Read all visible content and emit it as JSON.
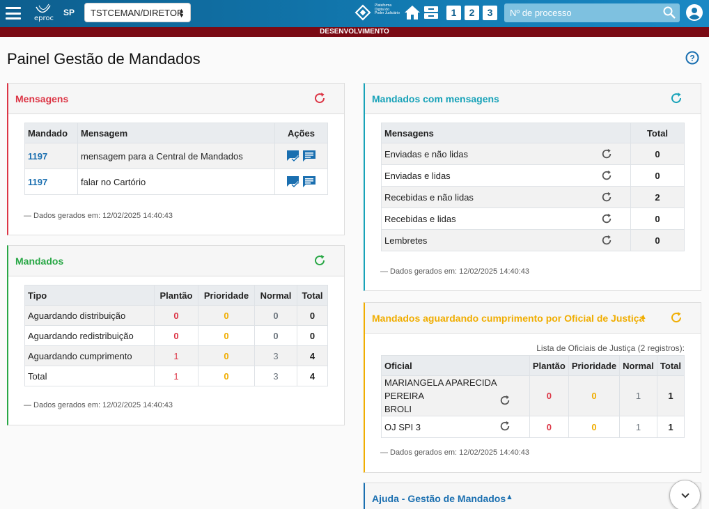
{
  "header": {
    "logo_text": "eproc",
    "region": "SP",
    "profile": "TSTCEMAN/DIRETOR",
    "platform_text": [
      "Plataforma",
      "Digital do",
      "Poder Judiciário"
    ],
    "shortcuts": [
      "1",
      "2",
      "3"
    ],
    "search_placeholder": "Nº de processo"
  },
  "env_banner": "DESENVOLVIMENTO",
  "page_title": "Painel Gestão de Mandados",
  "mensagens": {
    "title": "Mensagens",
    "columns": [
      "Mandado",
      "Mensagem",
      "Ações"
    ],
    "rows": [
      {
        "mandado": "1197",
        "mensagem": "mensagem para a Central de Mandados"
      },
      {
        "mandado": "1197",
        "mensagem": "falar no Cartório"
      }
    ],
    "footnote": "— Dados gerados em: 12/02/2025 14:40:43"
  },
  "mandados": {
    "title": "Mandados",
    "columns": [
      "Tipo",
      "Plantão",
      "Prioridade",
      "Normal",
      "Total"
    ],
    "rows": [
      {
        "tipo": "Aguardando distribuição",
        "plantao": "0",
        "prioridade": "0",
        "normal": "0",
        "total": "0"
      },
      {
        "tipo": "Aguardando redistribuição",
        "plantao": "0",
        "prioridade": "0",
        "normal": "0",
        "total": "0"
      },
      {
        "tipo": "Aguardando cumprimento",
        "plantao": "1",
        "prioridade": "0",
        "normal": "3",
        "total": "4"
      },
      {
        "tipo": "Total",
        "plantao": "1",
        "prioridade": "0",
        "normal": "3",
        "total": "4"
      }
    ],
    "footnote": "— Dados gerados em: 12/02/2025 14:40:43"
  },
  "mandados_mensagens": {
    "title": "Mandados com mensagens",
    "columns": [
      "Mensagens",
      "Total"
    ],
    "rows": [
      {
        "label": "Enviadas e não lidas",
        "total": "0"
      },
      {
        "label": "Enviadas e lidas",
        "total": "0"
      },
      {
        "label": "Recebidas e não lidas",
        "total": "2"
      },
      {
        "label": "Recebidas e lidas",
        "total": "0"
      },
      {
        "label": "Lembretes",
        "total": "0"
      }
    ],
    "footnote": "— Dados gerados em: 12/02/2025 14:40:43"
  },
  "oficiais": {
    "title": "Mandados aguardando cumprimento por Oficial de Justiça",
    "list_caption": "Lista de Oficiais de Justiça (2 registros):",
    "columns": [
      "Oficial",
      "Plantão",
      "Prioridade",
      "Normal",
      "Total"
    ],
    "rows": [
      {
        "oficial_l1": "MARIANGELA APARECIDA PEREIRA",
        "oficial_l2": "BROLI",
        "plantao": "0",
        "prioridade": "0",
        "normal": "1",
        "total": "1"
      },
      {
        "oficial_l1": "OJ SPI 3",
        "oficial_l2": "",
        "plantao": "0",
        "prioridade": "0",
        "normal": "1",
        "total": "1"
      }
    ],
    "footnote": "— Dados gerados em: 12/02/2025 14:40:43"
  },
  "ajuda": {
    "title": "Ajuda - Gestão de Mandados"
  },
  "colors": {
    "mensagens": "#dc3545",
    "mandados": "#28a745",
    "mandados_mensagens": "#17a2b8",
    "oficiais": "#f0ad00",
    "ajuda": "#1a6fb0"
  }
}
